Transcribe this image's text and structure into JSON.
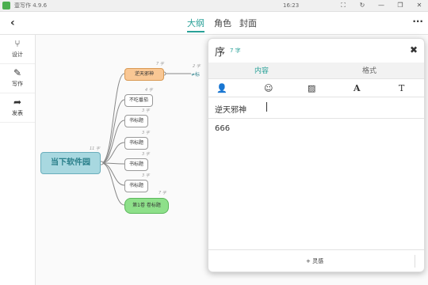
{
  "titlebar": {
    "app_title": "壹写作 4.9.6",
    "time": "16:23",
    "buttons": [
      "⛶",
      "↻",
      "—",
      "❐",
      "✕"
    ]
  },
  "topbar": {
    "back": "‹",
    "tabs": [
      "大纲",
      "角色",
      "封面"
    ],
    "active_tab": 0,
    "more": "···"
  },
  "sidebar": [
    {
      "icon": "⑂",
      "label": "设计"
    },
    {
      "icon": "✎",
      "label": "写作"
    },
    {
      "icon": "➦",
      "label": "发表"
    }
  ],
  "mindmap": {
    "root": {
      "label": "当下软件园",
      "count": "11 字"
    },
    "children": [
      {
        "label": "逆天邪神",
        "count": "7 字",
        "highlight": "orange"
      },
      {
        "label": "不吃番茄",
        "count": "4 字"
      },
      {
        "label": "书标题",
        "count": "3 字"
      },
      {
        "label": "书标题",
        "count": "3 字"
      },
      {
        "label": "书标题",
        "count": "3 字"
      },
      {
        "label": "书标题",
        "count": "3 字"
      },
      {
        "label": "第1卷 卷标题",
        "count": "7 字",
        "highlight": "green"
      }
    ],
    "extra": {
      "label": "≠标",
      "count": "2 字"
    },
    "colors": {
      "root": "#a8d8e0",
      "orange": "#f9c794",
      "green": "#8ee08a"
    }
  },
  "panel": {
    "title": "序",
    "count": "7 字",
    "tabs": [
      "内容",
      "格式"
    ],
    "active_tab": 0,
    "close": "✖",
    "tools": [
      "user-icon",
      "smile-icon",
      "image-icon",
      "font-icon",
      "text-icon"
    ],
    "tool_glyphs": [
      "👤",
      "☺",
      "▨",
      "A",
      "T"
    ],
    "name_value": "逆天邪神",
    "content": "666",
    "footer_add": "+ 灵感"
  },
  "accent": "#2aa198"
}
